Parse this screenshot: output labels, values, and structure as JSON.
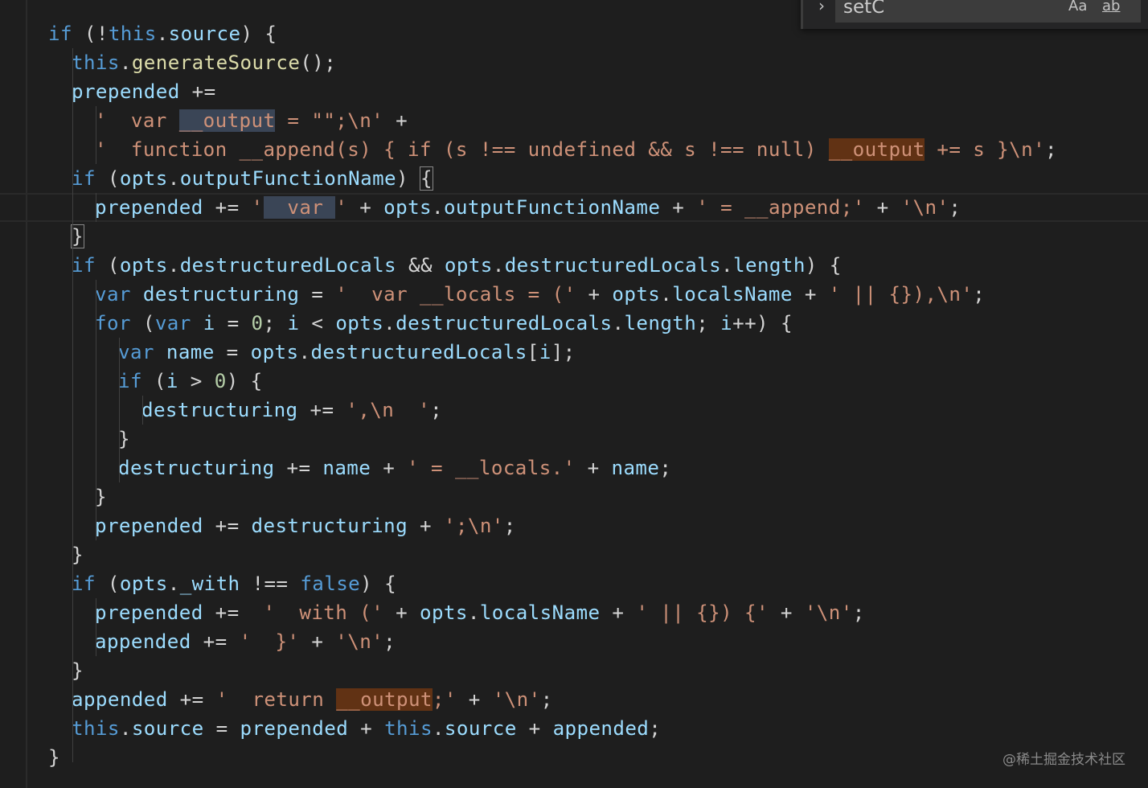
{
  "find_widget": {
    "toggle_icon": "chevron-right-icon",
    "query": "setC",
    "match_case_label": "Aa",
    "whole_word_label": "ab"
  },
  "code": [
    [
      {
        "t": "if",
        "c": "ctl"
      },
      {
        "t": " (!",
        "c": "p"
      },
      {
        "t": "this",
        "c": "kw"
      },
      {
        "t": ".",
        "c": "p"
      },
      {
        "t": "source",
        "c": "id"
      },
      {
        "t": ") {",
        "c": "p"
      }
    ],
    [
      {
        "t": "this",
        "c": "kw"
      },
      {
        "t": ".",
        "c": "p"
      },
      {
        "t": "generateSource",
        "c": "fn"
      },
      {
        "t": "();",
        "c": "p"
      }
    ],
    [
      {
        "t": "prepended",
        "c": "id"
      },
      {
        "t": " += ",
        "c": "p"
      }
    ],
    [
      {
        "t": "'  var ",
        "c": "str"
      },
      {
        "t": "__output",
        "c": "str",
        "h": "sel"
      },
      {
        "t": " = \"\";\\n'",
        "c": "str"
      },
      {
        "t": " +",
        "c": "p"
      }
    ],
    [
      {
        "t": "'  function __append(s) { if (s !== undefined && s !== null) ",
        "c": "str"
      },
      {
        "t": "__output",
        "c": "str",
        "h": "find"
      },
      {
        "t": " += s }\\n'",
        "c": "str"
      },
      {
        "t": ";",
        "c": "p"
      }
    ],
    [
      {
        "t": "if",
        "c": "ctl"
      },
      {
        "t": " (",
        "c": "p"
      },
      {
        "t": "opts",
        "c": "id"
      },
      {
        "t": ".",
        "c": "p"
      },
      {
        "t": "outputFunctionName",
        "c": "id"
      },
      {
        "t": ") ",
        "c": "p"
      },
      {
        "t": "{",
        "c": "p",
        "h": "br"
      }
    ],
    [
      {
        "t": "prepended",
        "c": "id"
      },
      {
        "t": " += ",
        "c": "p"
      },
      {
        "t": "'",
        "c": "str"
      },
      {
        "t": "  var ",
        "c": "str",
        "h": "sel"
      },
      {
        "t": "'",
        "c": "str"
      },
      {
        "t": " + ",
        "c": "p"
      },
      {
        "t": "opts",
        "c": "id"
      },
      {
        "t": ".",
        "c": "p"
      },
      {
        "t": "outputFunctionName",
        "c": "id"
      },
      {
        "t": " + ",
        "c": "p"
      },
      {
        "t": "' = __append;'",
        "c": "str"
      },
      {
        "t": " + ",
        "c": "p"
      },
      {
        "t": "'\\n'",
        "c": "str"
      },
      {
        "t": ";",
        "c": "p"
      }
    ],
    [
      {
        "t": "}",
        "c": "p",
        "h": "br"
      }
    ],
    [
      {
        "t": "if",
        "c": "ctl"
      },
      {
        "t": " (",
        "c": "p"
      },
      {
        "t": "opts",
        "c": "id"
      },
      {
        "t": ".",
        "c": "p"
      },
      {
        "t": "destructuredLocals",
        "c": "id"
      },
      {
        "t": " && ",
        "c": "p"
      },
      {
        "t": "opts",
        "c": "id"
      },
      {
        "t": ".",
        "c": "p"
      },
      {
        "t": "destructuredLocals",
        "c": "id"
      },
      {
        "t": ".",
        "c": "p"
      },
      {
        "t": "length",
        "c": "id"
      },
      {
        "t": ") {",
        "c": "p"
      }
    ],
    [
      {
        "t": "var",
        "c": "kw"
      },
      {
        "t": " ",
        "c": "p"
      },
      {
        "t": "destructuring",
        "c": "id"
      },
      {
        "t": " = ",
        "c": "p"
      },
      {
        "t": "'  var __locals = ('",
        "c": "str"
      },
      {
        "t": " + ",
        "c": "p"
      },
      {
        "t": "opts",
        "c": "id"
      },
      {
        "t": ".",
        "c": "p"
      },
      {
        "t": "localsName",
        "c": "id"
      },
      {
        "t": " + ",
        "c": "p"
      },
      {
        "t": "' || {}),\\n'",
        "c": "str"
      },
      {
        "t": ";",
        "c": "p"
      }
    ],
    [
      {
        "t": "for",
        "c": "ctl"
      },
      {
        "t": " (",
        "c": "p"
      },
      {
        "t": "var",
        "c": "kw"
      },
      {
        "t": " ",
        "c": "p"
      },
      {
        "t": "i",
        "c": "id"
      },
      {
        "t": " = ",
        "c": "p"
      },
      {
        "t": "0",
        "c": "num"
      },
      {
        "t": "; ",
        "c": "p"
      },
      {
        "t": "i",
        "c": "id"
      },
      {
        "t": " < ",
        "c": "p"
      },
      {
        "t": "opts",
        "c": "id"
      },
      {
        "t": ".",
        "c": "p"
      },
      {
        "t": "destructuredLocals",
        "c": "id"
      },
      {
        "t": ".",
        "c": "p"
      },
      {
        "t": "length",
        "c": "id"
      },
      {
        "t": "; ",
        "c": "p"
      },
      {
        "t": "i",
        "c": "id"
      },
      {
        "t": "++) {",
        "c": "p"
      }
    ],
    [
      {
        "t": "var",
        "c": "kw"
      },
      {
        "t": " ",
        "c": "p"
      },
      {
        "t": "name",
        "c": "id"
      },
      {
        "t": " = ",
        "c": "p"
      },
      {
        "t": "opts",
        "c": "id"
      },
      {
        "t": ".",
        "c": "p"
      },
      {
        "t": "destructuredLocals",
        "c": "id"
      },
      {
        "t": "[",
        "c": "p"
      },
      {
        "t": "i",
        "c": "id"
      },
      {
        "t": "];",
        "c": "p"
      }
    ],
    [
      {
        "t": "if",
        "c": "ctl"
      },
      {
        "t": " (",
        "c": "p"
      },
      {
        "t": "i",
        "c": "id"
      },
      {
        "t": " > ",
        "c": "p"
      },
      {
        "t": "0",
        "c": "num"
      },
      {
        "t": ") {",
        "c": "p"
      }
    ],
    [
      {
        "t": "destructuring",
        "c": "id"
      },
      {
        "t": " += ",
        "c": "p"
      },
      {
        "t": "',\\n  '",
        "c": "str"
      },
      {
        "t": ";",
        "c": "p"
      }
    ],
    [
      {
        "t": "}",
        "c": "p"
      }
    ],
    [
      {
        "t": "destructuring",
        "c": "id"
      },
      {
        "t": " += ",
        "c": "p"
      },
      {
        "t": "name",
        "c": "id"
      },
      {
        "t": " + ",
        "c": "p"
      },
      {
        "t": "' = __locals.'",
        "c": "str"
      },
      {
        "t": " + ",
        "c": "p"
      },
      {
        "t": "name",
        "c": "id"
      },
      {
        "t": ";",
        "c": "p"
      }
    ],
    [
      {
        "t": "}",
        "c": "p"
      }
    ],
    [
      {
        "t": "prepended",
        "c": "id"
      },
      {
        "t": " += ",
        "c": "p"
      },
      {
        "t": "destructuring",
        "c": "id"
      },
      {
        "t": " + ",
        "c": "p"
      },
      {
        "t": "';\\n'",
        "c": "str"
      },
      {
        "t": ";",
        "c": "p"
      }
    ],
    [
      {
        "t": "}",
        "c": "p"
      }
    ],
    [
      {
        "t": "if",
        "c": "ctl"
      },
      {
        "t": " (",
        "c": "p"
      },
      {
        "t": "opts",
        "c": "id"
      },
      {
        "t": ".",
        "c": "p"
      },
      {
        "t": "_with",
        "c": "id"
      },
      {
        "t": " !== ",
        "c": "p"
      },
      {
        "t": "false",
        "c": "kw"
      },
      {
        "t": ") {",
        "c": "p"
      }
    ],
    [
      {
        "t": "prepended",
        "c": "id"
      },
      {
        "t": " +=  ",
        "c": "p"
      },
      {
        "t": "'  with ('",
        "c": "str"
      },
      {
        "t": " + ",
        "c": "p"
      },
      {
        "t": "opts",
        "c": "id"
      },
      {
        "t": ".",
        "c": "p"
      },
      {
        "t": "localsName",
        "c": "id"
      },
      {
        "t": " + ",
        "c": "p"
      },
      {
        "t": "' || {}) {'",
        "c": "str"
      },
      {
        "t": " + ",
        "c": "p"
      },
      {
        "t": "'\\n'",
        "c": "str"
      },
      {
        "t": ";",
        "c": "p"
      }
    ],
    [
      {
        "t": "appended",
        "c": "id"
      },
      {
        "t": " += ",
        "c": "p"
      },
      {
        "t": "'  }'",
        "c": "str"
      },
      {
        "t": " + ",
        "c": "p"
      },
      {
        "t": "'\\n'",
        "c": "str"
      },
      {
        "t": ";",
        "c": "p"
      }
    ],
    [
      {
        "t": "}",
        "c": "p"
      }
    ],
    [
      {
        "t": "appended",
        "c": "id"
      },
      {
        "t": " += ",
        "c": "p"
      },
      {
        "t": "'  return ",
        "c": "str"
      },
      {
        "t": "__output",
        "c": "str",
        "h": "find"
      },
      {
        "t": ";'",
        "c": "str"
      },
      {
        "t": " + ",
        "c": "p"
      },
      {
        "t": "'\\n'",
        "c": "str"
      },
      {
        "t": ";",
        "c": "p"
      }
    ],
    [
      {
        "t": "this",
        "c": "kw"
      },
      {
        "t": ".",
        "c": "p"
      },
      {
        "t": "source",
        "c": "id"
      },
      {
        "t": " = ",
        "c": "p"
      },
      {
        "t": "prepended",
        "c": "id"
      },
      {
        "t": " + ",
        "c": "p"
      },
      {
        "t": "this",
        "c": "kw"
      },
      {
        "t": ".",
        "c": "p"
      },
      {
        "t": "source",
        "c": "id"
      },
      {
        "t": " + ",
        "c": "p"
      },
      {
        "t": "appended",
        "c": "id"
      },
      {
        "t": ";",
        "c": "p"
      }
    ],
    [
      {
        "t": "}",
        "c": "p"
      }
    ]
  ],
  "watermark": "@稀土掘金技术社区"
}
